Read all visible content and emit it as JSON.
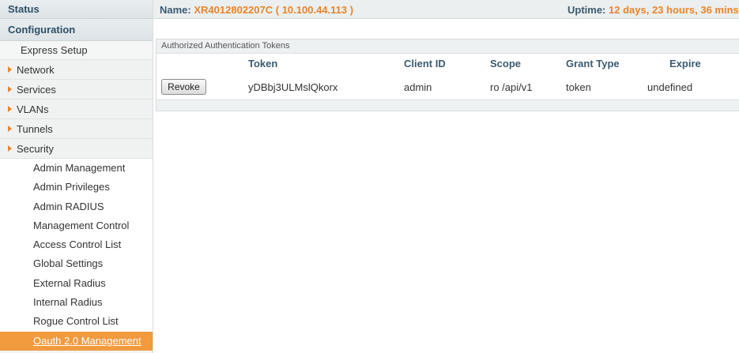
{
  "sidebar": {
    "status_label": "Status",
    "configuration_label": "Configuration",
    "express_setup": "Express Setup",
    "groups": [
      "Network",
      "Services",
      "VLANs",
      "Tunnels",
      "Security"
    ],
    "security_items": [
      "Admin Management",
      "Admin Privileges",
      "Admin RADIUS",
      "Management Control",
      "Access Control List",
      "Global Settings",
      "External Radius",
      "Internal Radius",
      "Rogue Control List",
      "Oauth 2.0 Management"
    ],
    "active_item": "Oauth 2.0 Management"
  },
  "header": {
    "name_label": "Name:",
    "name_value": "XR4012802207C",
    "ip_value": "( 10.100.44.113 )",
    "uptime_label": "Uptime:",
    "uptime_value": "12 days, 23 hours, 36 mins"
  },
  "panel": {
    "title": "Authorized Authentication Tokens",
    "columns": [
      "Token",
      "Client ID",
      "Scope",
      "Grant Type",
      "Expire"
    ],
    "rows": [
      {
        "action": "Revoke",
        "token": "yDBbj3ULMslQkorx",
        "client_id": "admin",
        "scope": "ro /api/v1",
        "grant_type": "token",
        "expire": "undefined"
      }
    ]
  },
  "colors": {
    "accent": "#e8852a",
    "active_bg": "#f19a3e",
    "header_text": "#3b5a70"
  }
}
